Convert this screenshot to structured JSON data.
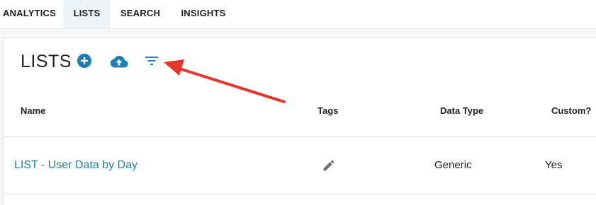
{
  "nav": {
    "tabs": [
      {
        "label": "ANALYTICS",
        "active": false
      },
      {
        "label": "LISTS",
        "active": true
      },
      {
        "label": "SEARCH",
        "active": false
      },
      {
        "label": "INSIGHTS",
        "active": false
      }
    ]
  },
  "lists_panel": {
    "title": "LISTS",
    "actions": [
      {
        "icon": "plus-circle-icon"
      },
      {
        "icon": "cloud-upload-icon"
      },
      {
        "icon": "filter-icon"
      }
    ],
    "columns": [
      "Name",
      "Tags",
      "Data Type",
      "Custom?"
    ],
    "rows": [
      {
        "name": "LIST - User Data by Day",
        "tags_icon": "pencil-icon",
        "data_type": "Generic",
        "custom": "Yes"
      }
    ]
  },
  "colors": {
    "accent": "#1e7fb6",
    "annotation_arrow": "#e8352b",
    "active_tab_bg": "#eef3f8"
  }
}
